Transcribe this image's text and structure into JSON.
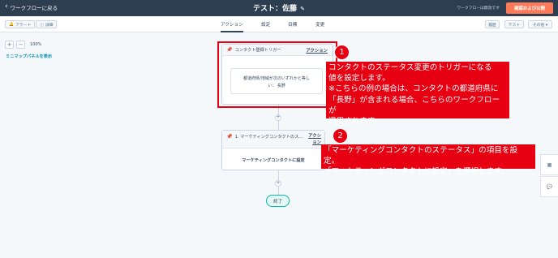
{
  "header": {
    "back_label": "ワークフローに戻る",
    "title": "テスト：佐藤",
    "workflow_status": "ワークフローは無効です",
    "publish_label": "確認および公開"
  },
  "toolbar": {
    "alert_label": "アラート",
    "details_label": "詳細",
    "tabs": [
      {
        "label": "アクション",
        "active": true
      },
      {
        "label": "設定",
        "active": false
      },
      {
        "label": "目標",
        "active": false
      },
      {
        "label": "変更",
        "active": false
      }
    ],
    "history_label": "履歴",
    "test_label": "テスト",
    "more_label": "その他 ▾"
  },
  "canvas": {
    "zoom_plus": "+",
    "zoom_minus": "−",
    "zoom_level": "100%",
    "minimap_label": "ミニマップパネルを表示"
  },
  "trigger_card": {
    "header": "コンタクト登録トリガー",
    "actions_label": "アクション",
    "condition_line1": "都道府県/地域が次のいずれかと等し",
    "condition_line2": "い： 長野"
  },
  "action_card": {
    "header": "1. マーケティングコンタクトのス...",
    "actions_label_1": "アクシ",
    "actions_label_2": "ョン",
    "body": "マーケティングコンタクトに設定"
  },
  "end_label": "終了",
  "annotations": {
    "badge1": "1",
    "badge2": "2",
    "note1": [
      "コンタクトのステータス変更のトリガーになる",
      "値を設定します。",
      "※こちらの例の場合は、コンタクトの都道府県に",
      "「長野」が含まれる場合、こちらのワークフローが",
      "適用されます。"
    ],
    "note2": [
      "「マーケティングコンタクトのステータス」の項目を設定。",
      "「マーケティングコンタクトに設定」を選択します。"
    ],
    "accent_color": "#e60012"
  },
  "icons": {
    "back": "chevron-left-icon",
    "edit": "pencil-icon",
    "trigger": "thumbtack-icon",
    "side_panel": "grid-icon",
    "chat": "chat-icon"
  }
}
